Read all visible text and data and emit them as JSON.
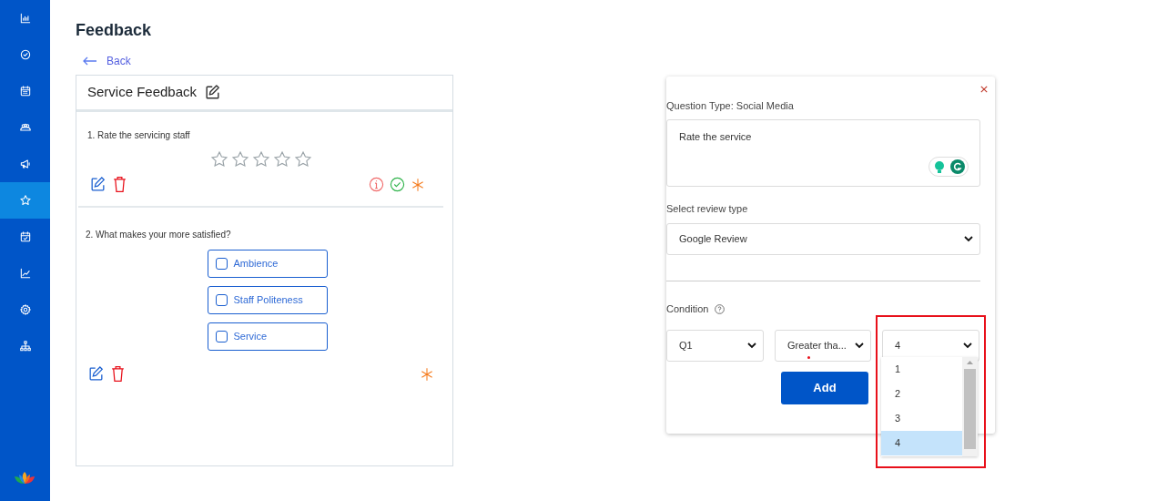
{
  "sidebar": {
    "items": [
      {
        "selected": false
      },
      {
        "selected": false
      },
      {
        "selected": false
      },
      {
        "selected": false
      },
      {
        "selected": false
      },
      {
        "selected": true
      },
      {
        "selected": false
      },
      {
        "selected": false
      },
      {
        "selected": false
      },
      {
        "selected": false
      }
    ]
  },
  "page": {
    "title": "Feedback",
    "back_link": "Back"
  },
  "form_card": {
    "title": "Service Feedback",
    "questions": [
      {
        "kind": "rating",
        "text": "1. Rate the servicing staff",
        "stars": 0
      },
      {
        "kind": "choices",
        "text": "2. What makes your more satisfied?",
        "options": [
          {
            "label": "Ambience",
            "checked": false
          },
          {
            "label": "Staff Politeness",
            "checked": false
          },
          {
            "label": "Service",
            "checked": false
          }
        ]
      }
    ]
  },
  "editor": {
    "question_type": "Question Type: Social Media",
    "question_text": "Rate the service",
    "review_type_label": "Select review type",
    "review_type": "Google Review",
    "condition_label": "Condition",
    "condition": {
      "question": "Q1",
      "operator": "Greater tha...",
      "value": "4"
    },
    "value_options": [
      {
        "label": "1",
        "selected": false
      },
      {
        "label": "2",
        "selected": false
      },
      {
        "label": "3",
        "selected": false
      },
      {
        "label": "4",
        "selected": true
      }
    ],
    "add_button": "Add",
    "highlighted": true
  }
}
